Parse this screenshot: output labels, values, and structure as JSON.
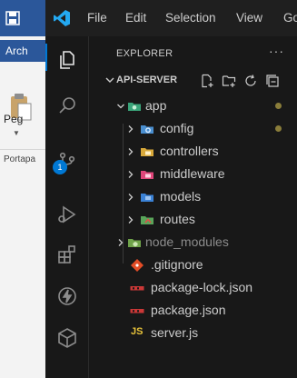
{
  "word": {
    "tab_label": "Arch",
    "paste_label": "Peg",
    "group_label": "Portapa"
  },
  "titlebar": {
    "menus": [
      "File",
      "Edit",
      "Selection",
      "View",
      "Go"
    ]
  },
  "activity_bar": {
    "items": [
      "explorer",
      "search",
      "source-control",
      "run-and-debug",
      "extensions",
      "thunder-client",
      "remote-explorer"
    ],
    "source_control_badge": "1"
  },
  "explorer": {
    "title": "EXPLORER",
    "more": "···",
    "folder_name": "API-SERVER",
    "toolbar": [
      "new-file",
      "new-folder",
      "refresh",
      "collapse-all"
    ],
    "tree": [
      {
        "name": "app",
        "type": "folder",
        "expanded": true,
        "color": "#8ed1a3",
        "icon": "folder-app-icon",
        "modified": true
      },
      {
        "name": "config",
        "type": "folder",
        "expanded": false,
        "color": "#cccccc",
        "icon": "folder-config-icon",
        "modified": true
      },
      {
        "name": "controllers",
        "type": "folder",
        "expanded": false,
        "color": "#cccccc",
        "icon": "folder-controllers-icon"
      },
      {
        "name": "middleware",
        "type": "folder",
        "expanded": false,
        "color": "#cccccc",
        "icon": "folder-middleware-icon"
      },
      {
        "name": "models",
        "type": "folder",
        "expanded": false,
        "color": "#cccccc",
        "icon": "folder-models-icon"
      },
      {
        "name": "routes",
        "type": "folder",
        "expanded": false,
        "color": "#cccccc",
        "icon": "folder-routes-icon"
      },
      {
        "name": "node_modules",
        "type": "folder",
        "expanded": false,
        "color": "#8c8c8c",
        "icon": "folder-node-icon"
      },
      {
        "name": ".gitignore",
        "type": "file",
        "color": "#cccccc",
        "icon": "git-icon"
      },
      {
        "name": "package-lock.json",
        "type": "file",
        "color": "#cccccc",
        "icon": "npm-icon"
      },
      {
        "name": "package.json",
        "type": "file",
        "color": "#cccccc",
        "icon": "npm-icon"
      },
      {
        "name": "server.js",
        "type": "file",
        "color": "#cccccc",
        "icon": "js-icon",
        "badge": "JS"
      }
    ]
  },
  "colors": {
    "accent": "#0078d4",
    "word_brand": "#2b579a",
    "modified_dot": "#8a7d3a"
  }
}
